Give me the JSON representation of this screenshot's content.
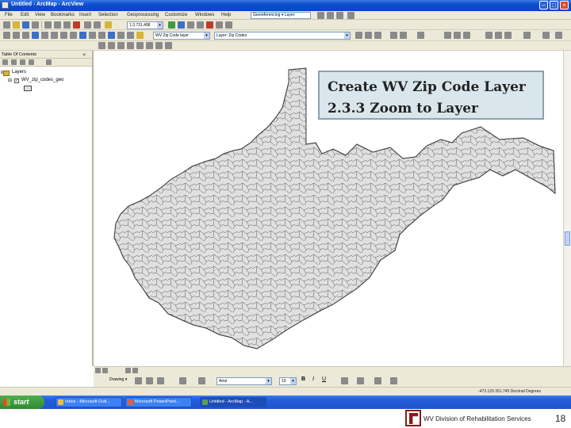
{
  "window": {
    "title": "Untitled - ArcMap - ArcView"
  },
  "menu": {
    "items": [
      "File",
      "Edit",
      "View",
      "Bookmarks",
      "Insert",
      "Selection",
      "Geoprocessing",
      "Customize",
      "Windows",
      "Help"
    ],
    "georef_combo": "Georeferencing ▾ Layer:"
  },
  "toolbar": {
    "scale_value": "1:3,731,498",
    "layer_combo": "WV Zip Code layer",
    "editor_combo": "Layer: Zip Codes"
  },
  "toc": {
    "title": "Table Of Contents",
    "root_label": "Layers",
    "layer_label": "WV_zip_codes_geo",
    "layer_checked": true
  },
  "callout": {
    "line1": "Create WV Zip Code Layer",
    "line2": "2.3.3 Zoom to Layer"
  },
  "drawing": {
    "drawing_label": "Drawing ▾",
    "font_name": "Arial",
    "font_size": "10"
  },
  "status": {
    "coordinates": "-473.129 351.745 Decimal Degrees"
  },
  "taskbar": {
    "start_label": "start",
    "tasks": [
      "Inbox - Microsoft Outl...",
      "Microsoft PowerPoint...",
      "Untitled - ArcMap - A..."
    ]
  },
  "footer": {
    "agency": "WV Division of Rehabilitation Services",
    "page_number": "18"
  },
  "colors": {
    "xp_blue": "#245edb",
    "map_fill": "#e0e0e0",
    "map_stroke": "#444444",
    "callout_fill": "#d9e7ed",
    "logo_red": "#8b1a1a"
  }
}
